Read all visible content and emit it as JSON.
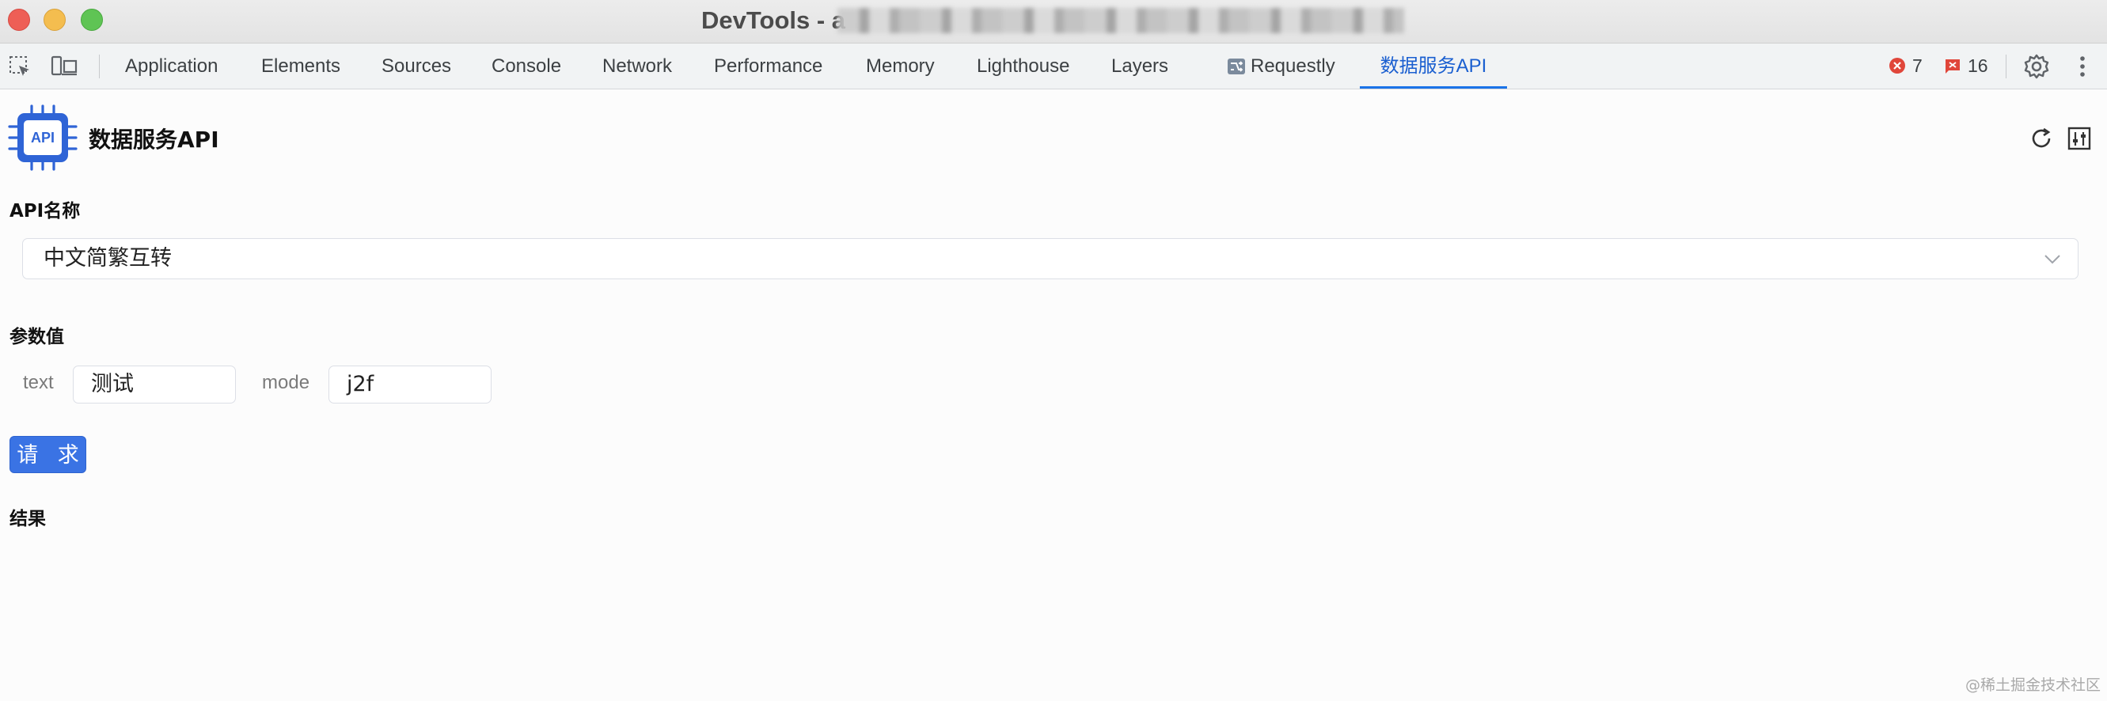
{
  "window": {
    "title": "DevTools - a"
  },
  "toolbar": {
    "tabs": [
      {
        "label": "Application"
      },
      {
        "label": "Elements"
      },
      {
        "label": "Sources"
      },
      {
        "label": "Console"
      },
      {
        "label": "Network"
      },
      {
        "label": "Performance"
      },
      {
        "label": "Memory"
      },
      {
        "label": "Lighthouse"
      },
      {
        "label": "Layers"
      },
      {
        "label": "Requestly"
      },
      {
        "label": "数据服务API"
      }
    ],
    "active_tab": "数据服务API",
    "errors_count": "7",
    "warnings_count": "16",
    "colors": {
      "accent": "#1a73e8",
      "error": "#e0463a"
    }
  },
  "panel": {
    "logo_text": "API",
    "title": "数据服务API",
    "api_name_label": "API名称",
    "api_select_value": "中文简繁互转",
    "params_label": "参数值",
    "params": [
      {
        "name": "text",
        "value": "测试"
      },
      {
        "name": "mode",
        "value": "j2f"
      }
    ],
    "request_button": "请 求",
    "result_label": "结果"
  },
  "watermark": "@稀土掘金技术社区"
}
